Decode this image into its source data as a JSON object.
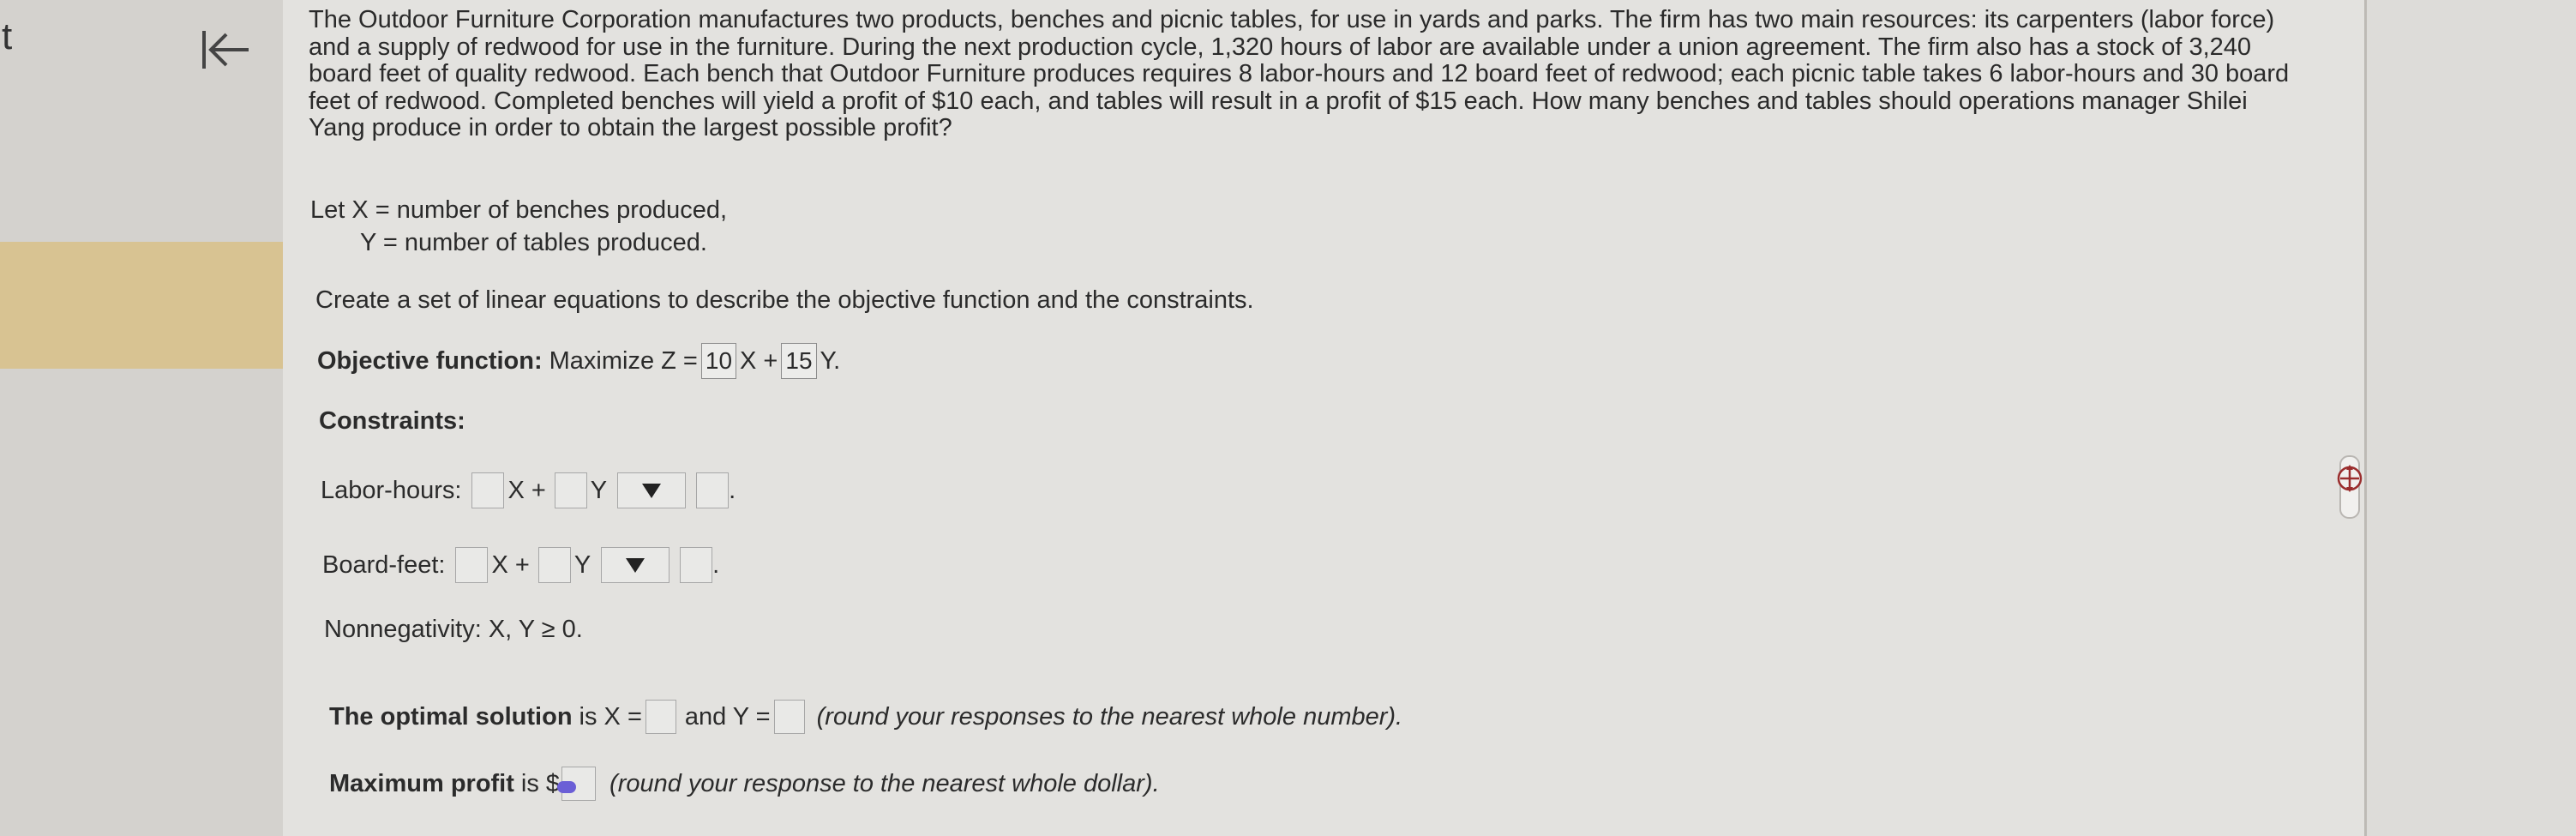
{
  "left": {
    "partial_text": "t"
  },
  "problem": {
    "text": "The Outdoor Furniture Corporation manufactures two products, benches and picnic tables, for use in yards and parks. The firm has two main resources: its carpenters (labor force) and a supply of redwood for use in the furniture. During the next production cycle, 1,320 hours of labor are available under a union agreement. The firm also has a stock of 3,240 board feet of quality redwood. Each bench that Outdoor Furniture produces requires 8 labor-hours and 12 board feet of redwood; each picnic table takes 6 labor-hours and 30 board feet of redwood. Completed benches will yield a profit of $10 each, and tables will result in a profit of $15 each. How many benches and tables should operations manager Shilei Yang produce in order to obtain the largest possible profit?"
  },
  "definitions": {
    "line1": "Let X = number of benches produced,",
    "line2": "Y = number of tables produced."
  },
  "instruction": "Create a set of linear equations to describe the objective function and the constraints.",
  "objective": {
    "label": "Objective function:",
    "text": "Maximize Z =",
    "x_coef": "10",
    "x_var": "X +",
    "y_coef": "15",
    "y_var": "Y."
  },
  "constraints": {
    "heading": "Constraints:",
    "labor": {
      "label": "Labor-hours:",
      "x_var": "X +",
      "y_var": "Y",
      "end": "."
    },
    "board": {
      "label": "Board-feet:",
      "x_var": "X +",
      "y_var": "Y",
      "end": "."
    },
    "nonneg": "Nonnegativity: X, Y ≥ 0."
  },
  "optimal": {
    "label": "The optimal solution",
    "is_x": "is X =",
    "and_y": "and Y =",
    "note": "(round your responses to the nearest whole number)."
  },
  "profit": {
    "label": "Maximum profit",
    "is": "is $",
    "note": "(round your response to the nearest whole dollar)."
  },
  "icons": {
    "back": "back-to-start-icon",
    "zoom": "zoom-move-icon"
  }
}
